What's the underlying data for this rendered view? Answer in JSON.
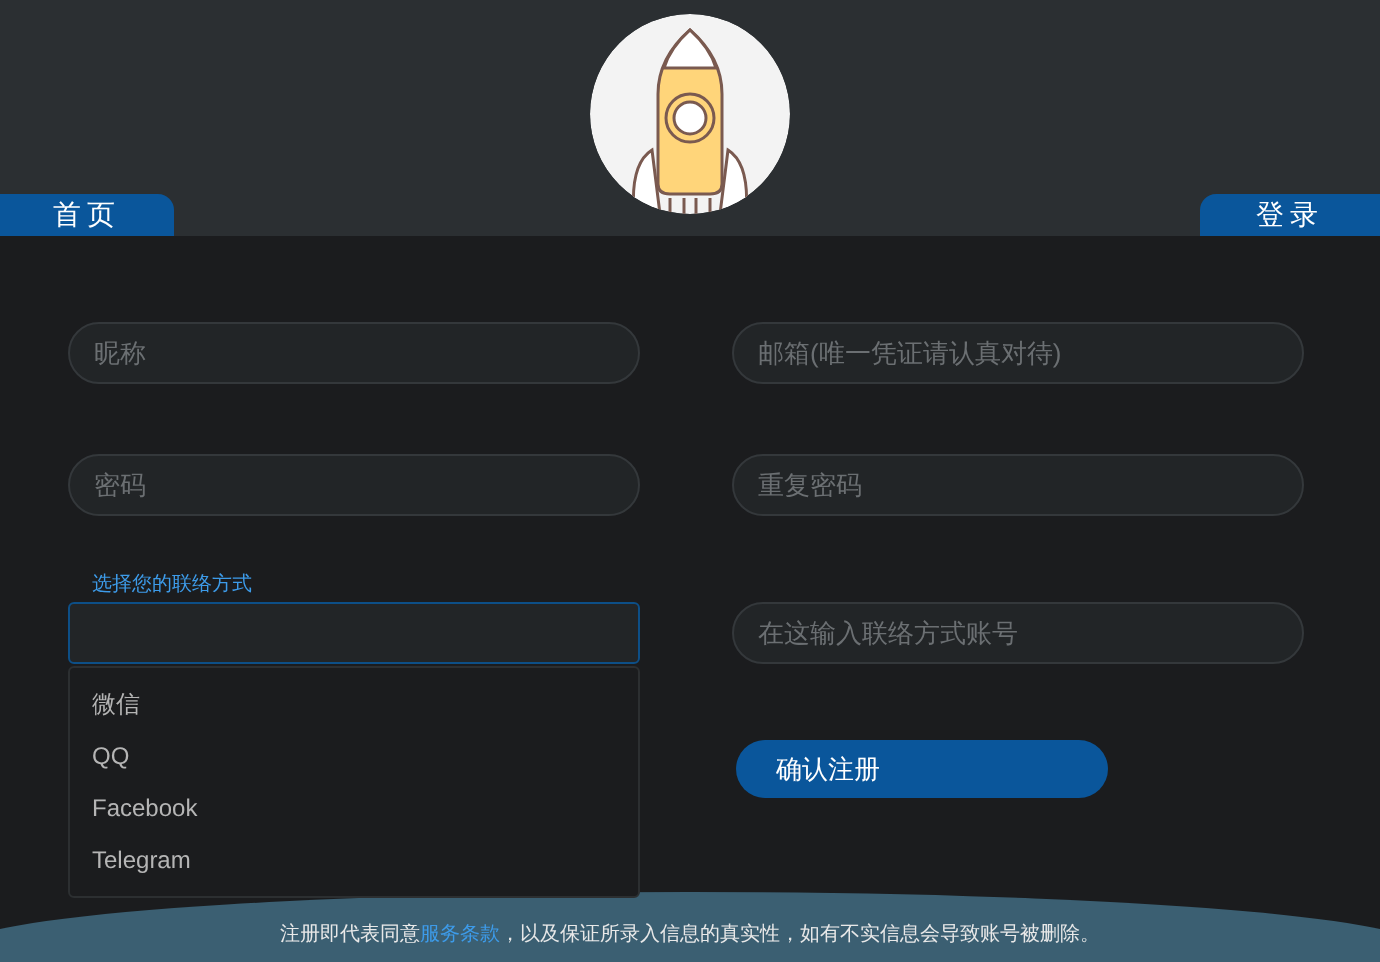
{
  "nav": {
    "left": "首页",
    "right": "登录"
  },
  "form": {
    "nickname": {
      "placeholder": "昵称"
    },
    "email": {
      "placeholder": "邮箱(唯一凭证请认真对待)"
    },
    "password": {
      "placeholder": "密码"
    },
    "repeat_password": {
      "placeholder": "重复密码"
    },
    "contact_method": {
      "label": "选择您的联络方式",
      "expanded": true,
      "options": [
        {
          "label": "微信",
          "selected": false
        },
        {
          "label": "QQ",
          "selected": false
        },
        {
          "label": "Facebook",
          "selected": false
        },
        {
          "label": "Telegram",
          "selected": false
        }
      ]
    },
    "contact_account": {
      "placeholder": "在这输入联络方式账号"
    },
    "submit": "确认注册"
  },
  "footer": {
    "before": "注册即代表同意",
    "link": "服务条款",
    "after": "，以及保证所录入信息的真实性，如有不实信息会导致账号被删除。"
  }
}
